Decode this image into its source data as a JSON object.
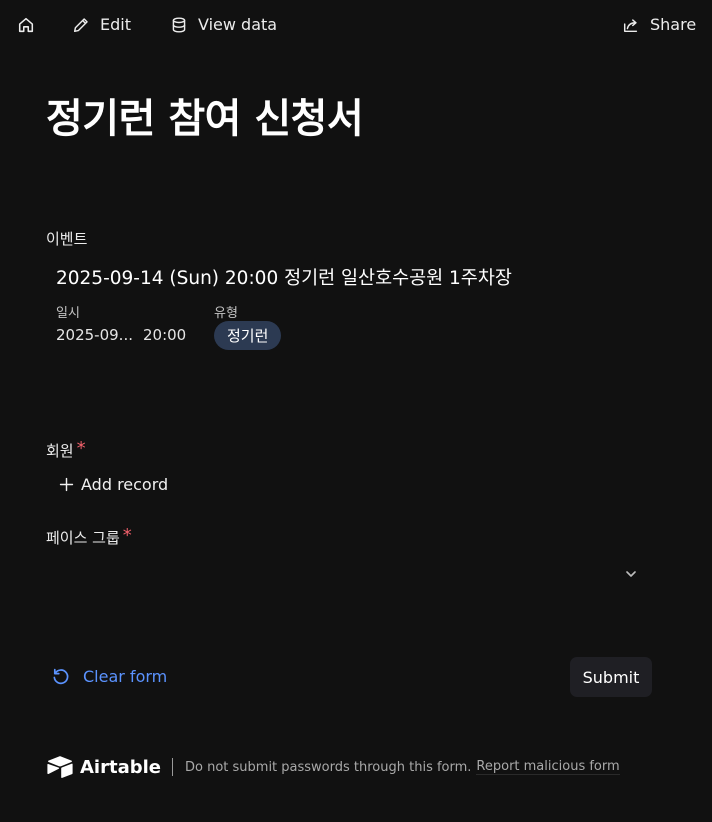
{
  "topbar": {
    "home_icon": "home-icon",
    "edit_label": "Edit",
    "view_data_label": "View data",
    "share_label": "Share"
  },
  "form": {
    "title": "정기런 참여 신청서",
    "event_field": {
      "label": "이벤트",
      "record": {
        "title": "2025-09-14 (Sun) 20:00 정기런 일산호수공원 1주차장",
        "date_label": "일시",
        "date_value": "2025-09...",
        "time_value": "20:00",
        "type_label": "유형",
        "type_value": "정기런",
        "type_pill_color": "#2c3a52"
      }
    },
    "member_field": {
      "label": "회원",
      "required_mark": "*",
      "add_record_label": "Add record"
    },
    "pace_group_field": {
      "label": "페이스 그룹",
      "required_mark": "*"
    },
    "clear_form_label": "Clear form",
    "submit_label": "Submit"
  },
  "footer": {
    "brand_name": "Airtable",
    "notice": "Do not submit passwords through this form.",
    "report_link": "Report malicious form"
  },
  "colors": {
    "background": "#111111",
    "accent_link": "#5b93ff",
    "required": "#f0606b"
  }
}
